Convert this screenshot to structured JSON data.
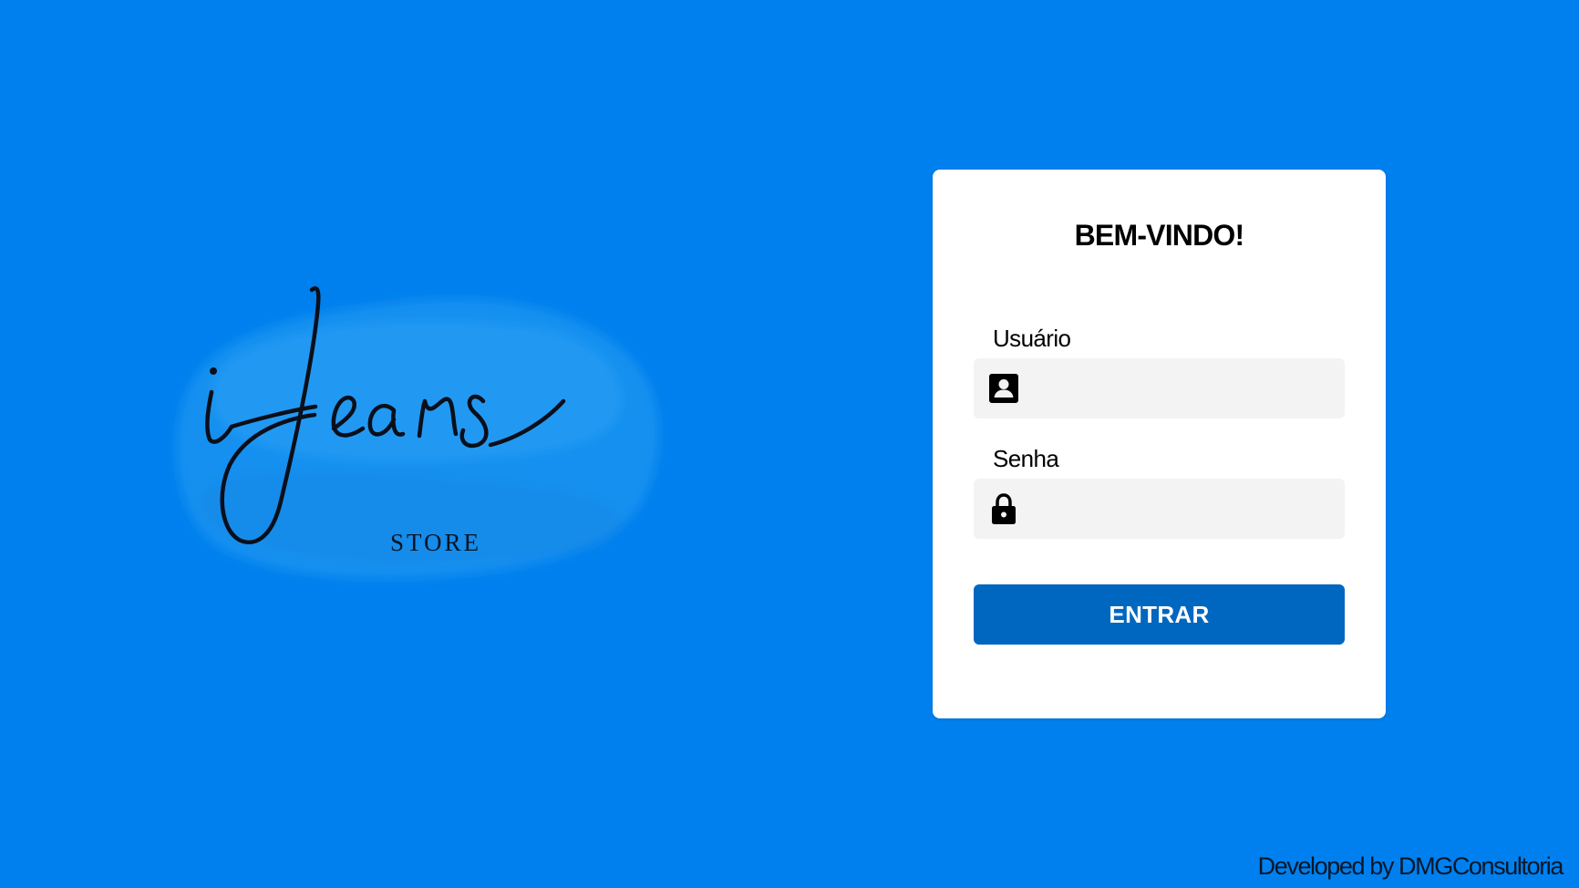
{
  "logo": {
    "script_text": "iJeans",
    "subtitle": "STORE",
    "brush_color": "#1a93f0"
  },
  "login": {
    "title": "BEM-VINDO!",
    "username_label": "Usuário",
    "username_value": "",
    "username_icon": "user-badge-icon",
    "password_label": "Senha",
    "password_value": "",
    "password_icon": "lock-icon",
    "submit_label": "ENTRAR"
  },
  "footer": {
    "credit": "Developed by DMGConsultoria"
  },
  "colors": {
    "background": "#0080ee",
    "card": "#ffffff",
    "input_background": "#f3f3f3",
    "button": "#0067c0",
    "button_text": "#ffffff"
  }
}
